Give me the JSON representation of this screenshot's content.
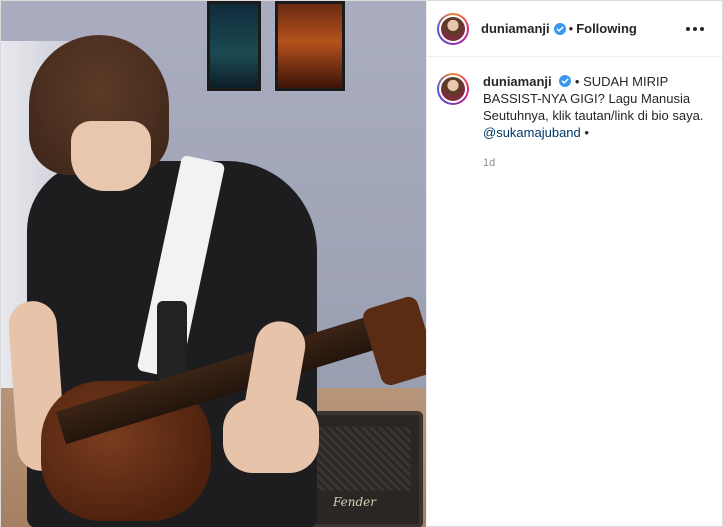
{
  "post": {
    "header": {
      "username": "duniamanji",
      "separator": "•",
      "follow_label": "Following"
    },
    "caption": {
      "username": "duniamanji",
      "separator": "•",
      "text": "SUDAH MIRIP BASSIST-NYA GIGI? Lagu Manusia Seutuhnya, klik tautan/link di bio saya.",
      "mention": "@sukamajuband",
      "trailing": "•",
      "time": "1d"
    },
    "media": {
      "amp_brand": "Fender"
    }
  },
  "colors": {
    "verified": "#3897f0",
    "mention": "#00376b",
    "muted": "#8e8e8e"
  },
  "icons": [
    "verified-badge-icon",
    "more-options-icon"
  ]
}
